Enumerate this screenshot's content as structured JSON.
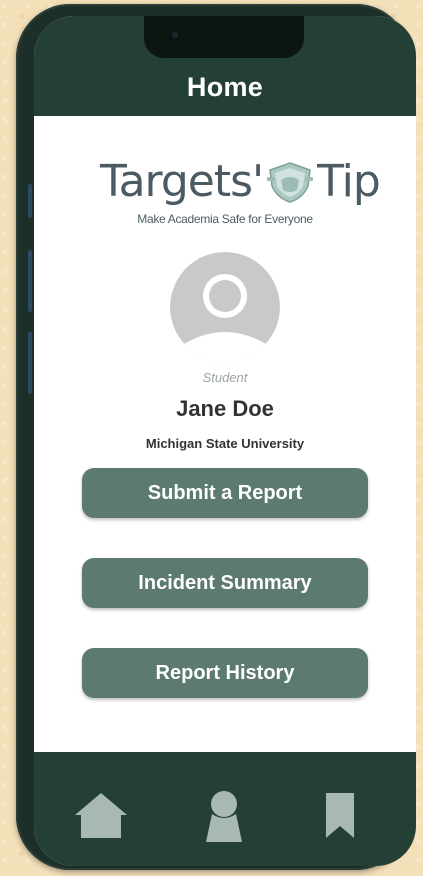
{
  "header": {
    "title": "Home"
  },
  "logo": {
    "name_left": "Targets'",
    "name_right": "Tip",
    "tagline": "Make Academia Safe for Everyone"
  },
  "profile": {
    "role": "Student",
    "name": "Jane Doe",
    "school": "Michigan State University"
  },
  "actions": {
    "submit_report": "Submit a Report",
    "incident_summary": "Incident Summary",
    "report_history": "Report History"
  },
  "tabbar": {
    "icons": [
      "home-icon",
      "profile-icon",
      "bookmark-icon"
    ]
  },
  "colors": {
    "header_bg": "#243f34",
    "button_bg": "#5d7a70",
    "tab_icon": "#a8b9b2",
    "page_bg": "#f3dfb8"
  }
}
